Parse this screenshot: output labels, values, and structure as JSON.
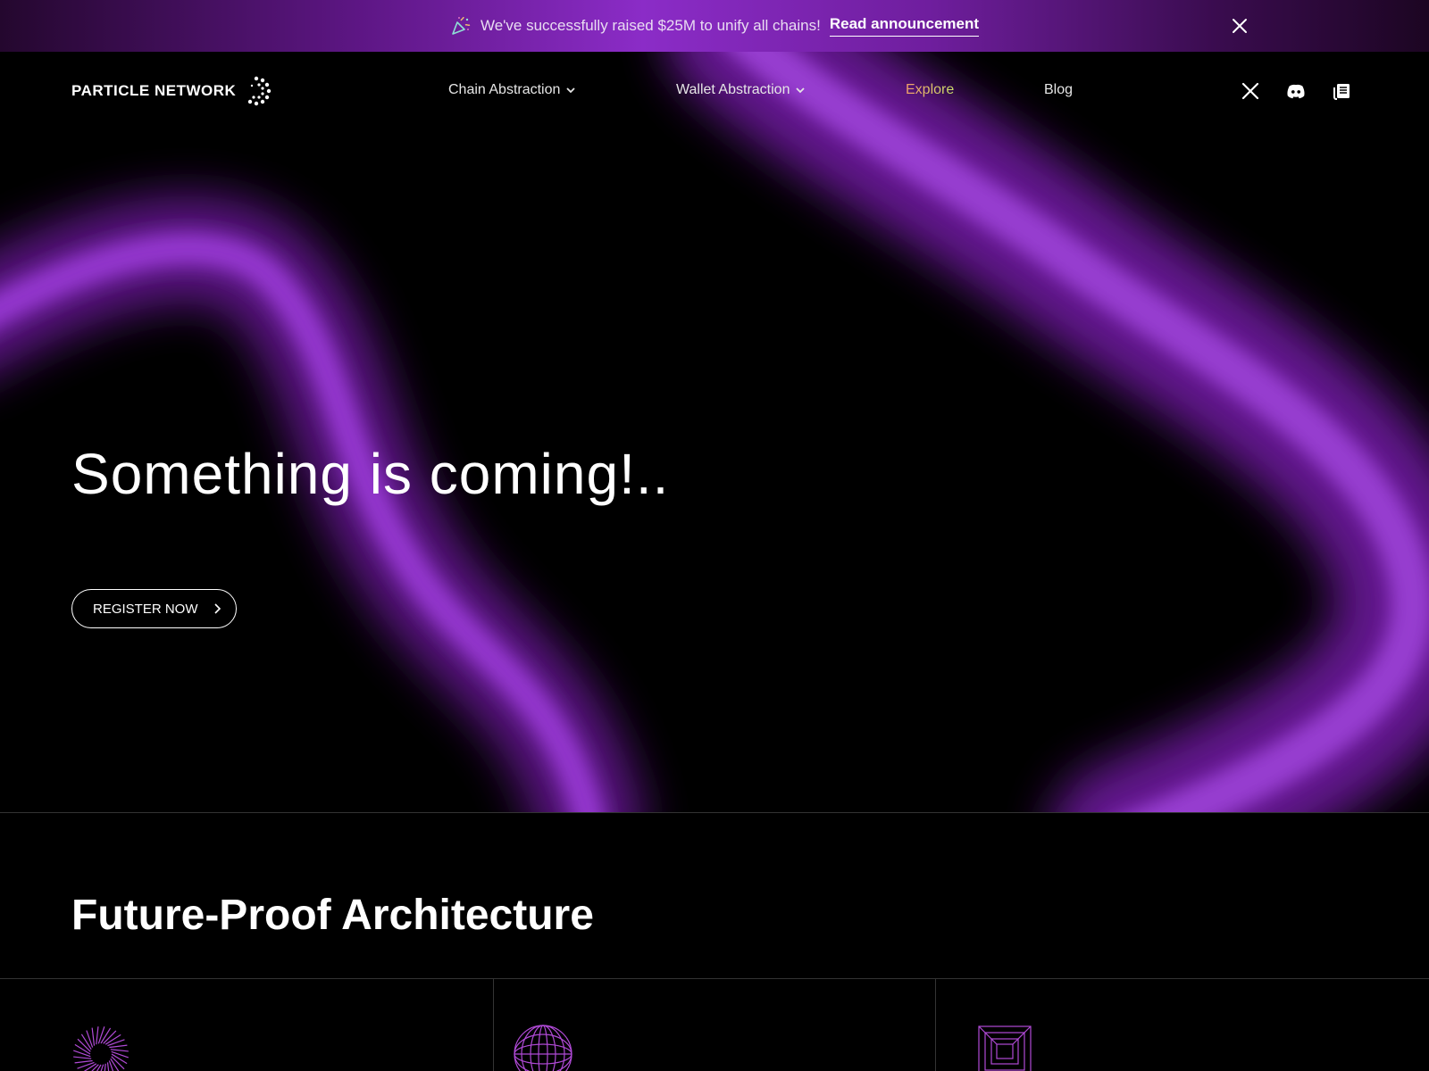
{
  "banner": {
    "message": "We've successfully raised $25M to unify all chains!",
    "cta": "Read announcement",
    "icons": {
      "party": "party-popper-icon",
      "close": "close-icon"
    }
  },
  "header": {
    "logo_text": "PARTICLE NETWORK",
    "nav": [
      {
        "label": "Chain Abstraction",
        "dropdown": true
      },
      {
        "label": "Wallet Abstraction",
        "dropdown": true
      },
      {
        "label": "Explore",
        "dropdown": false
      },
      {
        "label": "Blog",
        "dropdown": false
      }
    ],
    "social": [
      "x-twitter-icon",
      "discord-icon",
      "docs-icon"
    ]
  },
  "hero": {
    "title": "Something is coming!..",
    "cta": "REGISTER NOW"
  },
  "features": {
    "title": "Future-Proof Architecture",
    "icons": [
      "radial-lines-icon",
      "wireframe-globe-icon",
      "nested-squares-icon"
    ]
  },
  "colors": {
    "accent_purple": "#8b2cc7",
    "explore_gradient": [
      "#f2a06a",
      "#c9e06a"
    ],
    "background": "#000000"
  }
}
